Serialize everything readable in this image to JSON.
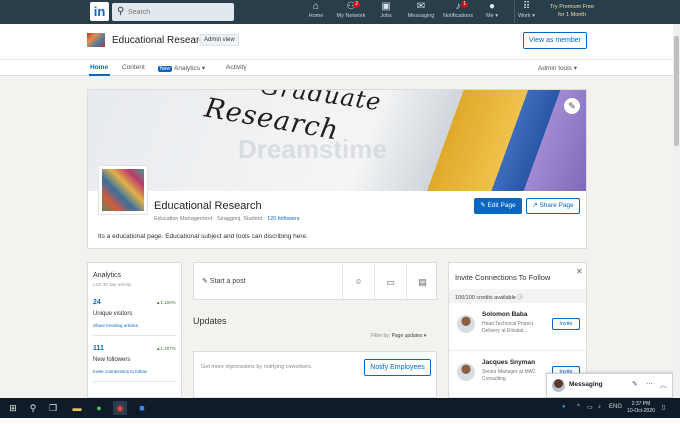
{
  "topnav": {
    "logo": "in",
    "search_placeholder": "Search",
    "items": [
      {
        "icon": "home-icon",
        "glyph": "⌂",
        "label": "Home"
      },
      {
        "icon": "network-icon",
        "glyph": "👥",
        "label": "My Network",
        "badge": "2"
      },
      {
        "icon": "jobs-icon",
        "glyph": "💼",
        "label": "Jobs"
      },
      {
        "icon": "messaging-icon",
        "glyph": "✉",
        "label": "Messaging"
      },
      {
        "icon": "bell-icon",
        "glyph": "🔔",
        "label": "Notifications",
        "badge": "1"
      },
      {
        "icon": "avatar",
        "glyph": "●",
        "label": "Me ▾"
      },
      {
        "icon": "grid-icon",
        "glyph": "⠿",
        "label": "Work ▾"
      }
    ],
    "premium_line1": "Try Premium Free",
    "premium_line2": "for 1 Month"
  },
  "page_header": {
    "title": "Educational Research",
    "admin_view": "Admin view",
    "view_as_member": "View as member"
  },
  "tabs": [
    {
      "label": "Home",
      "active": true
    },
    {
      "label": "Content"
    },
    {
      "label": "Analytics",
      "badge": "New"
    },
    {
      "label": "Activity"
    }
  ],
  "admin_tools": "Admin tools ▾",
  "banner": {
    "line1": "Graduate",
    "line2": "Research",
    "watermark": "Dreamstime"
  },
  "org": {
    "name": "Educational Research",
    "meta": "Education Management · Siraggonj, Student · ",
    "followers": "120 followers",
    "edit_page": "✎ Edit Page",
    "share_page": "↗ Share Page",
    "description": "Its a educational page. Educational subject and tools can discribing here."
  },
  "analytics": {
    "title": "Analytics",
    "subtitle": "Last 30 day activity",
    "metrics": [
      {
        "number": "24",
        "delta": "▲1,100%",
        "label": "Unique visitors",
        "link": "Share trending articles"
      },
      {
        "number": "111",
        "delta": "▲1,207%",
        "label": "New followers",
        "link": "Invite connections to follow"
      }
    ]
  },
  "post": {
    "start": "Start a post"
  },
  "updates": {
    "title": "Updates",
    "filter_label": "Filter by:",
    "filter_value": "Page updates ▾",
    "notify_text": "Get more impressions by notifying coworkers.",
    "notify_button": "Notify Employees"
  },
  "invite": {
    "title": "Invite Connections To Follow",
    "credits": "100/100 credits available ⓘ",
    "people": [
      {
        "name": "Solomon Baba",
        "role": "Head Technical Project Delivery at Etisalat...",
        "button": "Invite"
      },
      {
        "name": "Jacques Snyman",
        "role": "Senior Manager at MAC Consulting",
        "button": "Invite"
      }
    ]
  },
  "messaging": {
    "label": "Messaging"
  },
  "taskbar": {
    "time": "2:37 PM",
    "date": "10-Oct-2020",
    "lang": "ENG"
  },
  "colors": {
    "linkedin_blue": "#0a66c2",
    "topbar": "#283e4a",
    "taskbar": "#101b2a"
  }
}
